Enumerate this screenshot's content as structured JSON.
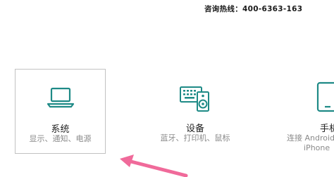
{
  "header": {
    "hotline_label": "咨询热线：",
    "hotline_number": "400-6363-163"
  },
  "tiles": [
    {
      "label": "系统",
      "description": "显示、通知、电源",
      "icon": "laptop-icon",
      "selected": true
    },
    {
      "label": "设备",
      "description": "蓝牙、打印机、鼠标",
      "icon": "keyboard-speaker-icon",
      "selected": false
    },
    {
      "label": "手机",
      "description_line1": "连接 Android",
      "description_line2": "iPhone",
      "icon": "phone-icon",
      "selected": false
    }
  ],
  "colors": {
    "accent_teal": "#1e8a86",
    "arrow_pink": "#f06a9a"
  }
}
